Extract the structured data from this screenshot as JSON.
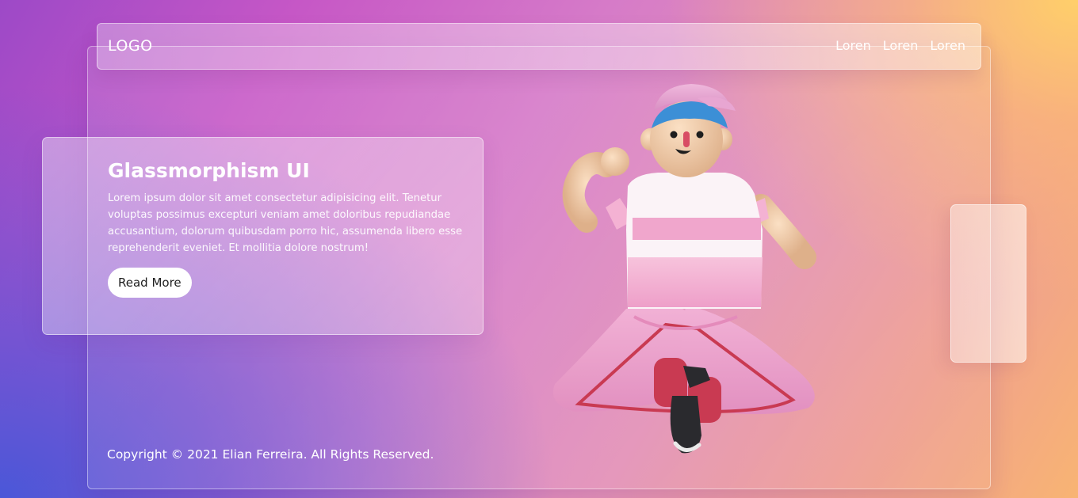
{
  "navbar": {
    "logo": "LOGO",
    "links": [
      {
        "label": "Loren"
      },
      {
        "label": "Loren"
      },
      {
        "label": "Loren"
      }
    ]
  },
  "hero": {
    "title": "Glassmorphism UI",
    "text": "Lorem ipsum dolor sit amet consectetur adipisicing elit. Tenetur voluptas possimus excepturi veniam amet doloribus repudiandae accusantium, dolorum quibusdam porro hic, assumenda libero esse reprehenderit eveniet. Et mollitia dolore nostrum!",
    "button_label": "Read More"
  },
  "footer": {
    "copyright": "Copyright © 2021 Elian Ferreira. All Rights Reserved."
  },
  "colors": {
    "background_top_right": "#ffcf6a",
    "background_bottom_left": "#4a57d8",
    "background_middle": "#d67bc8",
    "text": "#ffffff",
    "button_background": "#ffffff",
    "button_text": "#1e1e1e"
  },
  "illustration": {
    "subject": "3d-character-jumping",
    "colors": {
      "shirt": "#f4b7d4",
      "shirt_white": "#fbf3f7",
      "pants": "#ea9cc8",
      "stripe": "#c93a52",
      "skin": "#f0c9a3",
      "cap": "#e8a6d2",
      "hair": "#3c8fd6",
      "shoe": "#2a2a2e"
    }
  }
}
